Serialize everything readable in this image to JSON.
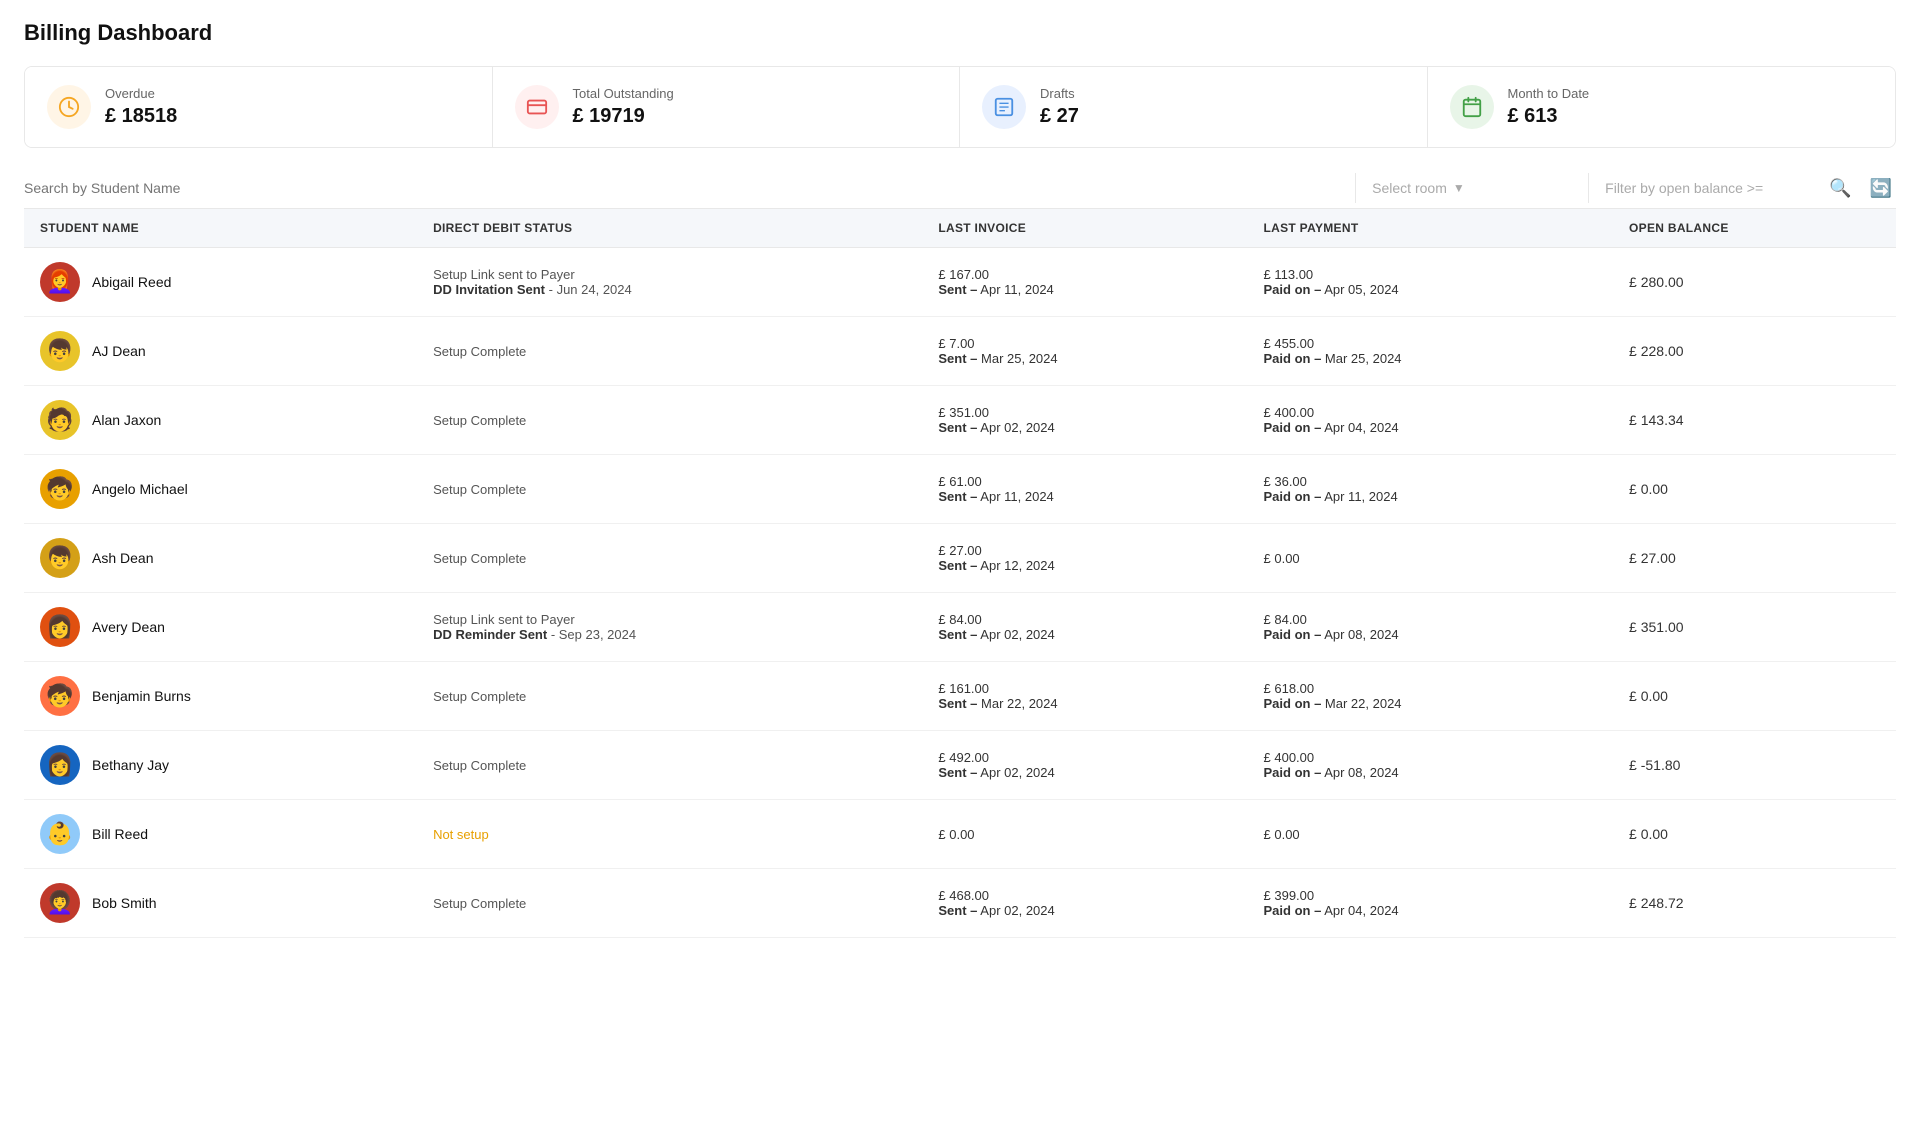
{
  "page": {
    "title": "Billing Dashboard"
  },
  "stats": [
    {
      "id": "overdue",
      "label": "Overdue",
      "value": "£ 18518",
      "icon": "⏱",
      "iconClass": "orange"
    },
    {
      "id": "total-outstanding",
      "label": "Total Outstanding",
      "value": "£ 19719",
      "icon": "💳",
      "iconClass": "red"
    },
    {
      "id": "drafts",
      "label": "Drafts",
      "value": "£ 27",
      "icon": "📋",
      "iconClass": "blue"
    },
    {
      "id": "month-to-date",
      "label": "Month to Date",
      "value": "£ 613",
      "icon": "📅",
      "iconClass": "green"
    }
  ],
  "filters": {
    "searchPlaceholder": "Search by Student Name",
    "roomPlaceholder": "Select room",
    "balancePlaceholder": "Filter by open balance >="
  },
  "table": {
    "columns": [
      {
        "id": "student-name",
        "label": "STUDENT NAME"
      },
      {
        "id": "direct-debit-status",
        "label": "DIRECT DEBIT STATUS"
      },
      {
        "id": "last-invoice",
        "label": "LAST INVOICE"
      },
      {
        "id": "last-payment",
        "label": "LAST PAYMENT"
      },
      {
        "id": "open-balance",
        "label": "OPEN BALANCE"
      }
    ],
    "rows": [
      {
        "id": "abigail-reed",
        "name": "Abigail Reed",
        "avatarEmoji": "👩",
        "avatarBg": "#e8305a",
        "ddStatusLine1": "Setup Link sent to Payer",
        "ddStatusLine2": "DD Invitation Sent",
        "ddStatusDate": "- Jun 24, 2024",
        "ddType": "link",
        "lastInvoiceAmount": "£ 167.00",
        "lastInvoiceLabel": "Sent",
        "lastInvoiceDate": "Apr 11, 2024",
        "lastPaymentAmount": "£ 113.00",
        "lastPaymentLabel": "Paid on",
        "lastPaymentDate": "Apr 05, 2024",
        "openBalance": "£ 280.00"
      },
      {
        "id": "aj-dean",
        "name": "AJ Dean",
        "avatarEmoji": "👦",
        "avatarBg": "#f5c842",
        "ddStatusLine1": "Setup Complete",
        "ddStatusLine2": "",
        "ddStatusDate": "",
        "ddType": "complete",
        "lastInvoiceAmount": "£ 7.00",
        "lastInvoiceLabel": "Sent",
        "lastInvoiceDate": "Mar 25, 2024",
        "lastPaymentAmount": "£ 455.00",
        "lastPaymentLabel": "Paid on",
        "lastPaymentDate": "Mar 25, 2024",
        "openBalance": "£ 228.00"
      },
      {
        "id": "alan-jaxon",
        "name": "Alan Jaxon",
        "avatarEmoji": "👦",
        "avatarBg": "#f5c842",
        "ddStatusLine1": "Setup Complete",
        "ddStatusLine2": "",
        "ddStatusDate": "",
        "ddType": "complete",
        "lastInvoiceAmount": "£ 351.00",
        "lastInvoiceLabel": "Sent",
        "lastInvoiceDate": "Apr 02, 2024",
        "lastPaymentAmount": "£ 400.00",
        "lastPaymentLabel": "Paid on",
        "lastPaymentDate": "Apr 04, 2024",
        "openBalance": "£ 143.34"
      },
      {
        "id": "angelo-michael",
        "name": "Angelo Michael",
        "avatarEmoji": "🧒",
        "avatarBg": "#e8a000",
        "ddStatusLine1": "Setup Complete",
        "ddStatusLine2": "",
        "ddStatusDate": "",
        "ddType": "complete",
        "lastInvoiceAmount": "£ 61.00",
        "lastInvoiceLabel": "Sent",
        "lastInvoiceDate": "Apr 11, 2024",
        "lastPaymentAmount": "£ 36.00",
        "lastPaymentLabel": "Paid on",
        "lastPaymentDate": "Apr 11, 2024",
        "openBalance": "£ 0.00"
      },
      {
        "id": "ash-dean",
        "name": "Ash Dean",
        "avatarEmoji": "👦",
        "avatarBg": "#f5c842",
        "ddStatusLine1": "Setup Complete",
        "ddStatusLine2": "",
        "ddStatusDate": "",
        "ddType": "complete",
        "lastInvoiceAmount": "£ 27.00",
        "lastInvoiceLabel": "Sent",
        "lastInvoiceDate": "Apr 12, 2024",
        "lastPaymentAmount": "£ 0.00",
        "lastPaymentLabel": "",
        "lastPaymentDate": "",
        "openBalance": "£ 27.00"
      },
      {
        "id": "avery-dean",
        "name": "Avery Dean",
        "avatarEmoji": "👩",
        "avatarBg": "#e8305a",
        "ddStatusLine1": "Setup Link sent to Payer",
        "ddStatusLine2": "DD Reminder Sent",
        "ddStatusDate": "- Sep 23, 2024",
        "ddType": "link",
        "lastInvoiceAmount": "£ 84.00",
        "lastInvoiceLabel": "Sent",
        "lastInvoiceDate": "Apr 02, 2024",
        "lastPaymentAmount": "£ 84.00",
        "lastPaymentLabel": "Paid on",
        "lastPaymentDate": "Apr 08, 2024",
        "openBalance": "£ 351.00"
      },
      {
        "id": "benjamin-burns",
        "name": "Benjamin Burns",
        "avatarEmoji": "🧒",
        "avatarBg": "#ff7043",
        "ddStatusLine1": "Setup Complete",
        "ddStatusLine2": "",
        "ddStatusDate": "",
        "ddType": "complete",
        "lastInvoiceAmount": "£ 161.00",
        "lastInvoiceLabel": "Sent",
        "lastInvoiceDate": "Mar 22, 2024",
        "lastPaymentAmount": "£ 618.00",
        "lastPaymentLabel": "Paid on",
        "lastPaymentDate": "Mar 22, 2024",
        "openBalance": "£ 0.00"
      },
      {
        "id": "bethany-jay",
        "name": "Bethany Jay",
        "avatarEmoji": "👩",
        "avatarBg": "#4a90e2",
        "ddStatusLine1": "Setup Complete",
        "ddStatusLine2": "",
        "ddStatusDate": "",
        "ddType": "complete",
        "lastInvoiceAmount": "£ 492.00",
        "lastInvoiceLabel": "Sent",
        "lastInvoiceDate": "Apr 02, 2024",
        "lastPaymentAmount": "£ 400.00",
        "lastPaymentLabel": "Paid on",
        "lastPaymentDate": "Apr 08, 2024",
        "openBalance": "£ -51.80"
      },
      {
        "id": "bill-reed",
        "name": "Bill Reed",
        "avatarEmoji": "👶",
        "avatarBg": "#90caf9",
        "ddStatusLine1": "Not setup",
        "ddStatusLine2": "",
        "ddStatusDate": "",
        "ddType": "notsetup",
        "lastInvoiceAmount": "£ 0.00",
        "lastInvoiceLabel": "",
        "lastInvoiceDate": "",
        "lastPaymentAmount": "£ 0.00",
        "lastPaymentLabel": "",
        "lastPaymentDate": "",
        "openBalance": "£ 0.00"
      },
      {
        "id": "bob-smith",
        "name": "Bob Smith",
        "avatarEmoji": "👩",
        "avatarBg": "#e8305a",
        "ddStatusLine1": "Setup Complete",
        "ddStatusLine2": "",
        "ddStatusDate": "",
        "ddType": "complete",
        "lastInvoiceAmount": "£ 468.00",
        "lastInvoiceLabel": "Sent",
        "lastInvoiceDate": "Apr 02, 2024",
        "lastPaymentAmount": "£ 399.00",
        "lastPaymentLabel": "Paid on",
        "lastPaymentDate": "Apr 04, 2024",
        "openBalance": "£ 248.72"
      }
    ]
  }
}
